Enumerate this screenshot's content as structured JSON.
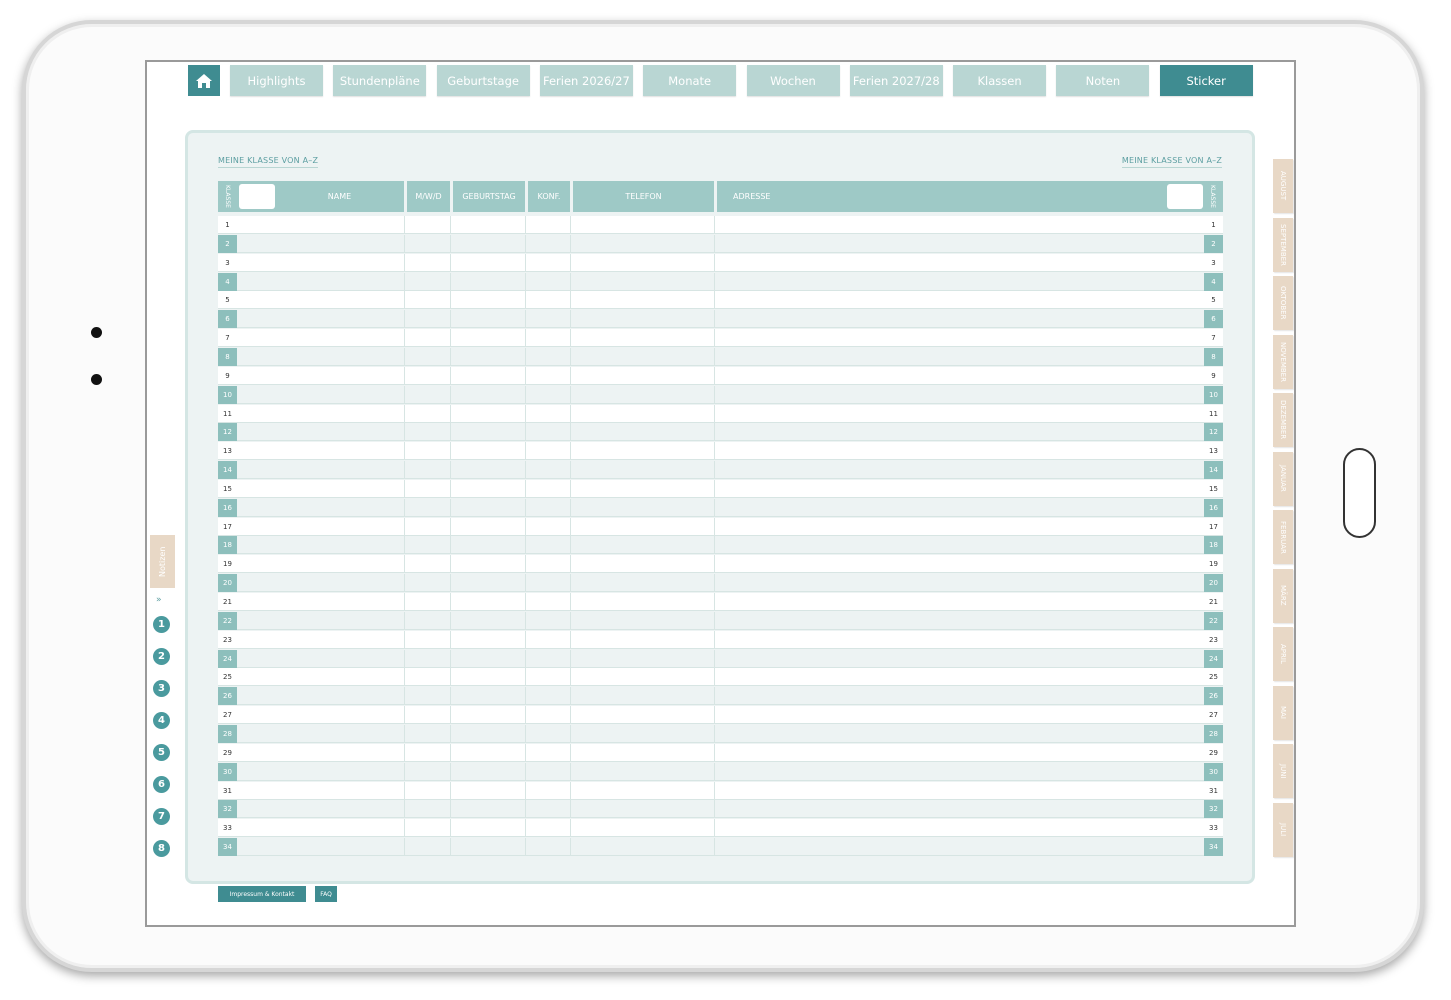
{
  "nav": {
    "home_icon": "home-icon",
    "tabs": [
      "Highlights",
      "Stundenpläne",
      "Geburtstage",
      "Ferien 2026/27",
      "Monate",
      "Wochen",
      "Ferien 2027/28",
      "Klassen",
      "Noten",
      "Sticker"
    ],
    "active_tab": "Sticker"
  },
  "page": {
    "title_left": "MEINE KLASSE VON A–Z",
    "title_right": "MEINE KLASSE VON A–Z"
  },
  "table": {
    "klasse_label_left": "KLASSE",
    "klasse_label_right": "KLASSE",
    "columns": [
      "NAME",
      "M/W/D",
      "GEBURTSTAG",
      "KONF.",
      "TELEFON",
      "ADRESSE"
    ],
    "row_numbers": [
      "1",
      "2",
      "3",
      "4",
      "5",
      "6",
      "7",
      "8",
      "9",
      "10",
      "11",
      "12",
      "13",
      "14",
      "15",
      "16",
      "17",
      "18",
      "19",
      "20",
      "21",
      "22",
      "23",
      "24",
      "25",
      "26",
      "27",
      "28",
      "29",
      "30",
      "31",
      "32",
      "33",
      "34"
    ]
  },
  "months": [
    "AUGUST",
    "SEPTEMBER",
    "OKTOBER",
    "NOVEMBER",
    "DEZEMBER",
    "JANUAR",
    "FEBRUAR",
    "MÄRZ",
    "APRIL",
    "MAI",
    "JUNI",
    "JULI"
  ],
  "sidebar": {
    "notizen": "Notizen",
    "chevron_icon": "double-chevron-down-icon",
    "numbers": [
      "1",
      "2",
      "3",
      "4",
      "5",
      "6",
      "7",
      "8"
    ]
  },
  "footer": {
    "impressum": "Impressum & Kontakt",
    "faq": "FAQ"
  },
  "colors": {
    "accent": "#3f8c91",
    "tab": "#b9d6d3",
    "header": "#9ec9c6",
    "month_tab": "#e8d8c6"
  }
}
